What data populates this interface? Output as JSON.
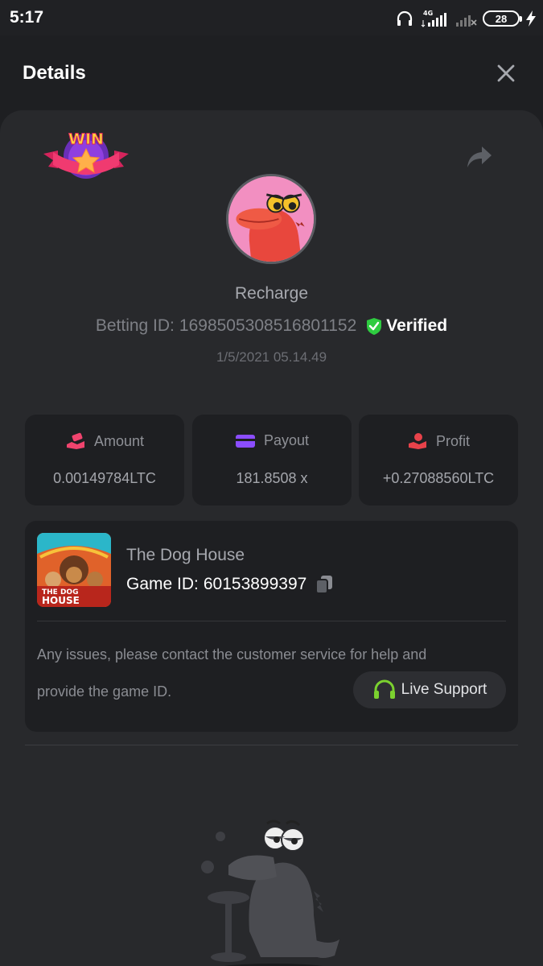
{
  "status_bar": {
    "time": "5:17",
    "network": "4G",
    "battery": "28",
    "icons": [
      "headphones-icon",
      "signal-icon",
      "signal-off-icon",
      "battery-icon",
      "charging-icon"
    ]
  },
  "header": {
    "title": "Details",
    "close_icon": "close-icon"
  },
  "record": {
    "badge_text": "WIN",
    "share_icon": "share-icon",
    "type": "Recharge",
    "betting_id_label": "Betting ID:",
    "betting_id": "1698505308516801152",
    "verified_label": "Verified",
    "date": "1/5/2021 05.14.49"
  },
  "stats": [
    {
      "icon": "money-hand-icon",
      "label": "Amount",
      "value": "0.00149784LTC"
    },
    {
      "icon": "wallet-card-icon",
      "label": "Payout",
      "value": "181.8508 x"
    },
    {
      "icon": "profit-hand-icon",
      "label": "Profit",
      "value": "+0.27088560LTC"
    }
  ],
  "game": {
    "name": "The Dog House",
    "game_id_label": "Game ID:",
    "game_id": "60153899397",
    "thumb_text_1": "THE DOG",
    "thumb_text_2": "HOUSE",
    "help_line_1": "Any issues, please contact the customer service for help and",
    "help_line_2": "provide the game ID.",
    "live_support_label": "Live Support"
  },
  "colors": {
    "background": "#1e1f22",
    "sheet": "#28292c",
    "verified_green": "#2ecc40",
    "payout_purple": "#8b4dff",
    "profit_red": "#e8424a",
    "amount_pink": "#f0446e",
    "support_green": "#7bd12f"
  }
}
